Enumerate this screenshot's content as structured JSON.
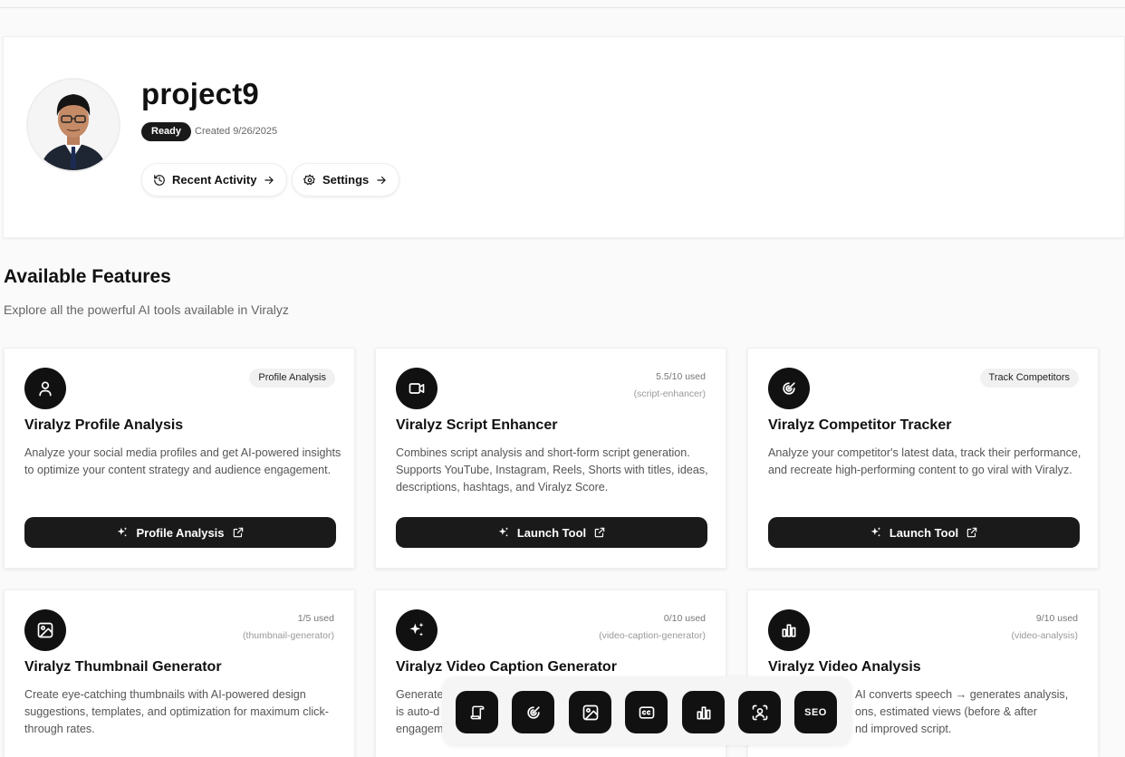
{
  "project": {
    "title": "project9",
    "status": "Ready",
    "created": "Created 9/26/2025",
    "recent_activity_label": "Recent Activity",
    "settings_label": "Settings"
  },
  "section": {
    "title": "Available Features",
    "subtitle": "Explore all the powerful AI tools available in Viralyz"
  },
  "cards": [
    {
      "icon": "user-icon",
      "tag": "Profile Analysis",
      "title": "Viralyz Profile Analysis",
      "desc": "Analyze your social media profiles and get AI-powered insights to optimize your content strategy and audience engagement.",
      "button": "Profile Analysis"
    },
    {
      "icon": "video-icon",
      "usage": "5.5/10 used",
      "slug": "(script-enhancer)",
      "title": "Viralyz Script Enhancer",
      "desc": "Combines script analysis and short-form script generation. Supports YouTube, Instagram, Reels, Shorts with titles, ideas, descriptions, hashtags, and Viralyz Score.",
      "button": "Launch Tool"
    },
    {
      "icon": "radar-icon",
      "tag": "Track Competitors",
      "title": "Viralyz Competitor Tracker",
      "desc": "Analyze your competitor's latest data, track their performance, and recreate high-performing content to go viral with Viralyz.",
      "button": "Launch Tool"
    },
    {
      "icon": "image-icon",
      "usage": "1/5 used",
      "slug": "(thumbnail-generator)",
      "title": "Viralyz Thumbnail Generator",
      "desc": "Create eye-catching thumbnails with AI-powered design suggestions, templates, and optimization for maximum click-through rates."
    },
    {
      "icon": "sparkles-icon",
      "usage": "0/10 used",
      "slug": "(video-caption-generator)",
      "title": "Viralyz Video Caption Generator",
      "desc_visible_1": "Generate",
      "desc_visible_2": "is auto-d",
      "desc_visible_3": "engagem"
    },
    {
      "icon": "bar-chart-icon",
      "usage": "9/10 used",
      "slug": "(video-analysis)",
      "title": "Viralyz Video Analysis",
      "desc_visible_1": "AI converts speech → generates analysis,",
      "desc_visible_2": "ons, estimated views (before & after",
      "desc_visible_3": "nd improved script."
    }
  ],
  "dock": {
    "items": [
      "script-icon",
      "radar-icon",
      "image-icon",
      "captions-icon",
      "bar-chart-icon",
      "scan-face-icon",
      "seo-icon"
    ],
    "seo_label": "SEO"
  },
  "colors": {
    "primary": "#1a1a1a",
    "background": "#fafafa",
    "muted_text": "#666666"
  }
}
